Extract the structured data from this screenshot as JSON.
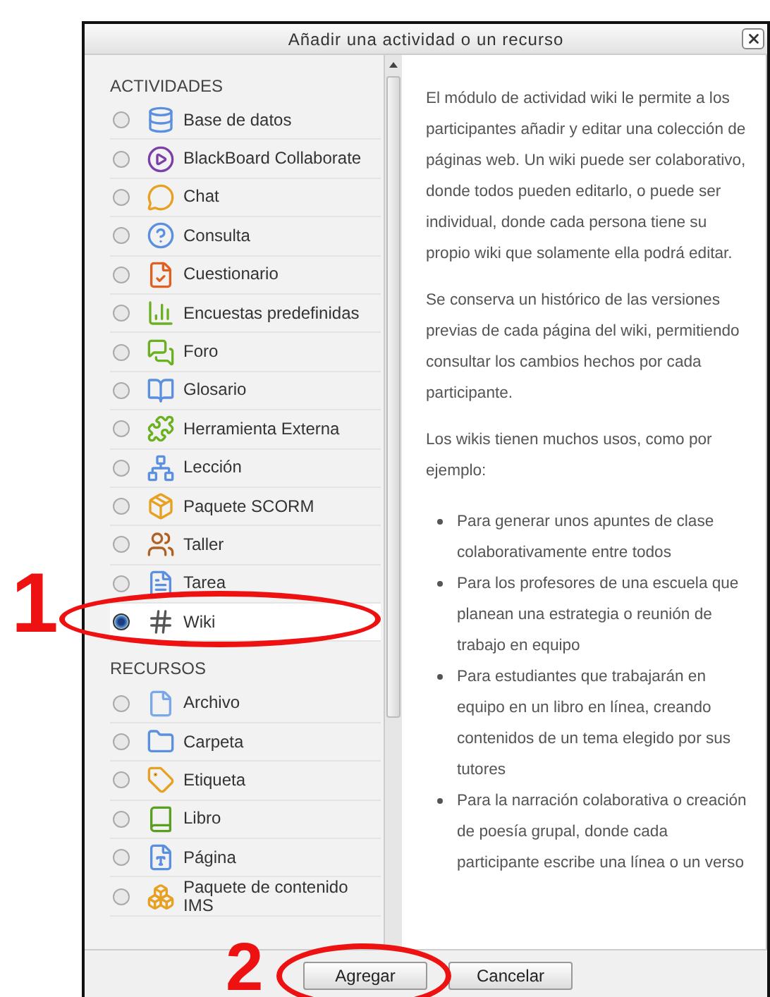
{
  "dialog": {
    "title": "Añadir una actividad o un recurso"
  },
  "sections": [
    {
      "heading": "ACTIVIDADES",
      "items": [
        {
          "label": "Base de datos",
          "selected": false
        },
        {
          "label": "BlackBoard Collaborate",
          "selected": false
        },
        {
          "label": "Chat",
          "selected": false
        },
        {
          "label": "Consulta",
          "selected": false
        },
        {
          "label": "Cuestionario",
          "selected": false
        },
        {
          "label": "Encuestas predefinidas",
          "selected": false
        },
        {
          "label": "Foro",
          "selected": false
        },
        {
          "label": "Glosario",
          "selected": false
        },
        {
          "label": "Herramienta Externa",
          "selected": false
        },
        {
          "label": "Lección",
          "selected": false
        },
        {
          "label": "Paquete SCORM",
          "selected": false
        },
        {
          "label": "Taller",
          "selected": false
        },
        {
          "label": "Tarea",
          "selected": false
        },
        {
          "label": "Wiki",
          "selected": true
        }
      ]
    },
    {
      "heading": "RECURSOS",
      "items": [
        {
          "label": "Archivo",
          "selected": false
        },
        {
          "label": "Carpeta",
          "selected": false
        },
        {
          "label": "Etiqueta",
          "selected": false
        },
        {
          "label": "Libro",
          "selected": false
        },
        {
          "label": "Página",
          "selected": false
        },
        {
          "label": "Paquete de contenido IMS",
          "selected": false
        }
      ]
    }
  ],
  "description": {
    "paragraphs": [
      "El módulo de actividad wiki le permite a los participantes añadir y editar una colección de páginas web. Un wiki puede ser colaborativo, donde todos pueden editarlo, o puede ser individual, donde cada persona tiene su propio wiki que solamente ella podrá editar.",
      "Se conserva un histórico de las versiones previas de cada página del wiki, permitiendo consultar los cambios hechos por cada participante.",
      "Los wikis tienen muchos usos, como por ejemplo:"
    ],
    "bullets": [
      "Para generar unos apuntes de clase colaborativamente entre todos",
      "Para los profesores de una escuela que planean una estrategia o reunión de trabajo en equipo",
      "Para estudiantes que trabajarán en equipo en un libro en línea, creando contenidos de un tema elegido por sus tutores",
      "Para la narración colaborativa o creación de poesía grupal, donde cada participante escribe una línea o un verso"
    ]
  },
  "buttons": [
    "Agregar",
    "Cancelar"
  ],
  "annotations": [
    "1",
    "2"
  ]
}
